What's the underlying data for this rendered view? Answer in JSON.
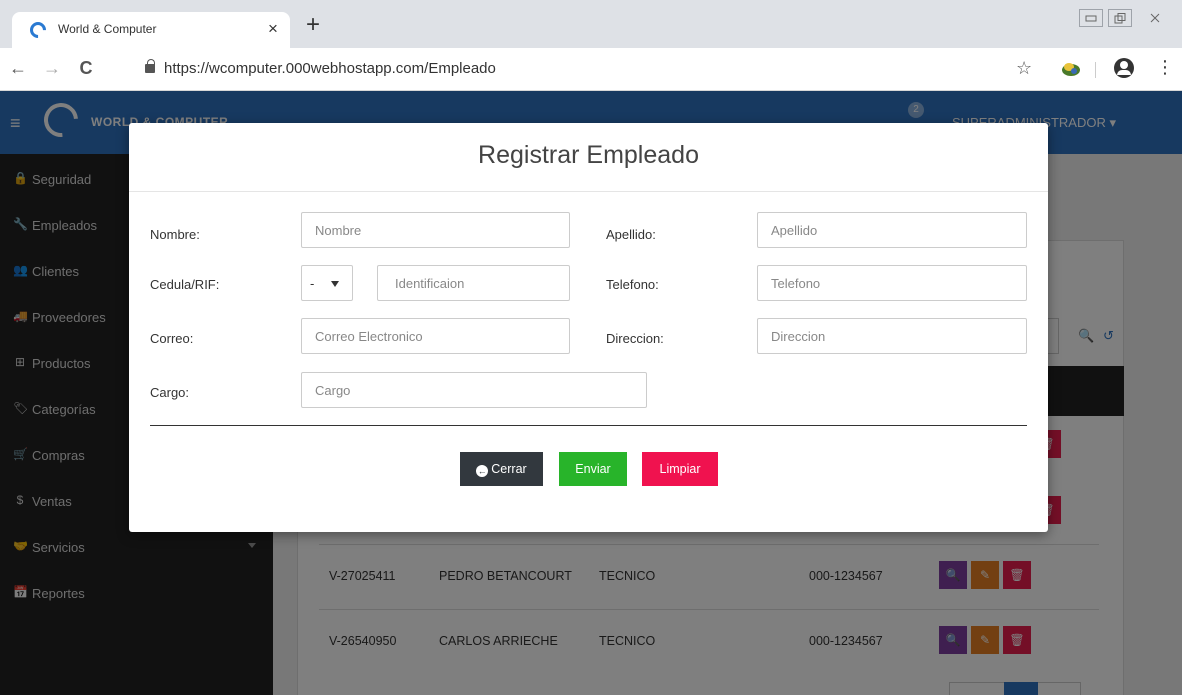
{
  "browser": {
    "tab_title": "World & Computer",
    "tab_close": "×",
    "new_tab": "+",
    "url": "https://wcomputer.000webhostapp.com/Empleado",
    "back": "←",
    "forward": "→",
    "reload": "C",
    "star": "☆",
    "menu": "⋮"
  },
  "app": {
    "hamburger": "≡",
    "logo_text": "WORLD & COMPUTER",
    "notification_count": "2",
    "user_menu": "SUPERADMINISTRADOR ▾"
  },
  "sidebar": {
    "items": [
      {
        "label": "Seguridad",
        "icon": "🔒"
      },
      {
        "label": "Empleados",
        "icon": "🔧"
      },
      {
        "label": "Clientes",
        "icon": "👥"
      },
      {
        "label": "Proveedores",
        "icon": "🚚"
      },
      {
        "label": "Productos",
        "icon": "⊞"
      },
      {
        "label": "Categorías",
        "icon": "🏷"
      },
      {
        "label": "Compras",
        "icon": "🛒"
      },
      {
        "label": "Ventas",
        "icon": "$"
      },
      {
        "label": "Servicios",
        "icon": "🤝"
      },
      {
        "label": "Reportes",
        "icon": "📅"
      }
    ]
  },
  "table": {
    "rows": [
      {
        "cedula": "V-27025411",
        "nombre": "PEDRO BETANCOURT",
        "cargo": "TECNICO",
        "telefono": "000-1234567"
      },
      {
        "cedula": "V-26540950",
        "nombre": "CARLOS ARRIECHE",
        "cargo": "TECNICO",
        "telefono": "000-1234567"
      }
    ],
    "search_icon": "🔍",
    "reset_icon": "↺",
    "view_icon": "🔍",
    "edit_icon": "✎",
    "delete_icon": "🗑"
  },
  "modal": {
    "title": "Registrar Empleado",
    "fields": {
      "nombre": {
        "label": "Nombre:",
        "placeholder": "Nombre"
      },
      "apellido": {
        "label": "Apellido:",
        "placeholder": "Apellido"
      },
      "cedula": {
        "label": "Cedula/RIF:",
        "select_value": "-",
        "placeholder": "Identificaion"
      },
      "telefono": {
        "label": "Telefono:",
        "placeholder": "Telefono"
      },
      "correo": {
        "label": "Correo:",
        "placeholder": "Correo Electronico"
      },
      "direccion": {
        "label": "Direccion:",
        "placeholder": "Direccion"
      },
      "cargo": {
        "label": "Cargo:",
        "placeholder": "Cargo"
      }
    },
    "buttons": {
      "close_icon": "←",
      "close": "Cerrar",
      "send": "Enviar",
      "clear": "Limpiar"
    }
  },
  "colors": {
    "primary": "#2f73c0",
    "sidebar": "#222222",
    "send": "#28b42a",
    "clear": "#f0124f",
    "close": "#32383e"
  }
}
